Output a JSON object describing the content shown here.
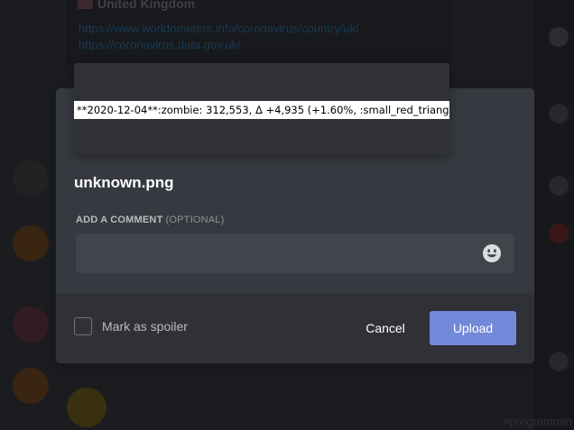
{
  "background": {
    "embed_title": "United Kingdom",
    "links": [
      "https://www.worldometers.info/coronavirus/country/uk/",
      "https://coronavirus.data.gov.uk/"
    ],
    "channel_hint": "#programmin"
  },
  "modal": {
    "preview_text": "**2020-12-04**:zombie: 312,553, Δ +4,935 (+1.60%, :small_red_triangl",
    "filename": "unknown.png",
    "comment_label": "ADD A COMMENT",
    "comment_optional": "(OPTIONAL)",
    "comment_value": "",
    "comment_placeholder": "",
    "emoji_icon": "smiley-face-icon",
    "spoiler_label": "Mark as spoiler",
    "spoiler_checked": false,
    "cancel_label": "Cancel",
    "upload_label": "Upload"
  },
  "colors": {
    "accent": "#7289da",
    "modal_bg": "#36393f",
    "footer_bg": "#2f3136",
    "input_bg": "#40444b"
  }
}
